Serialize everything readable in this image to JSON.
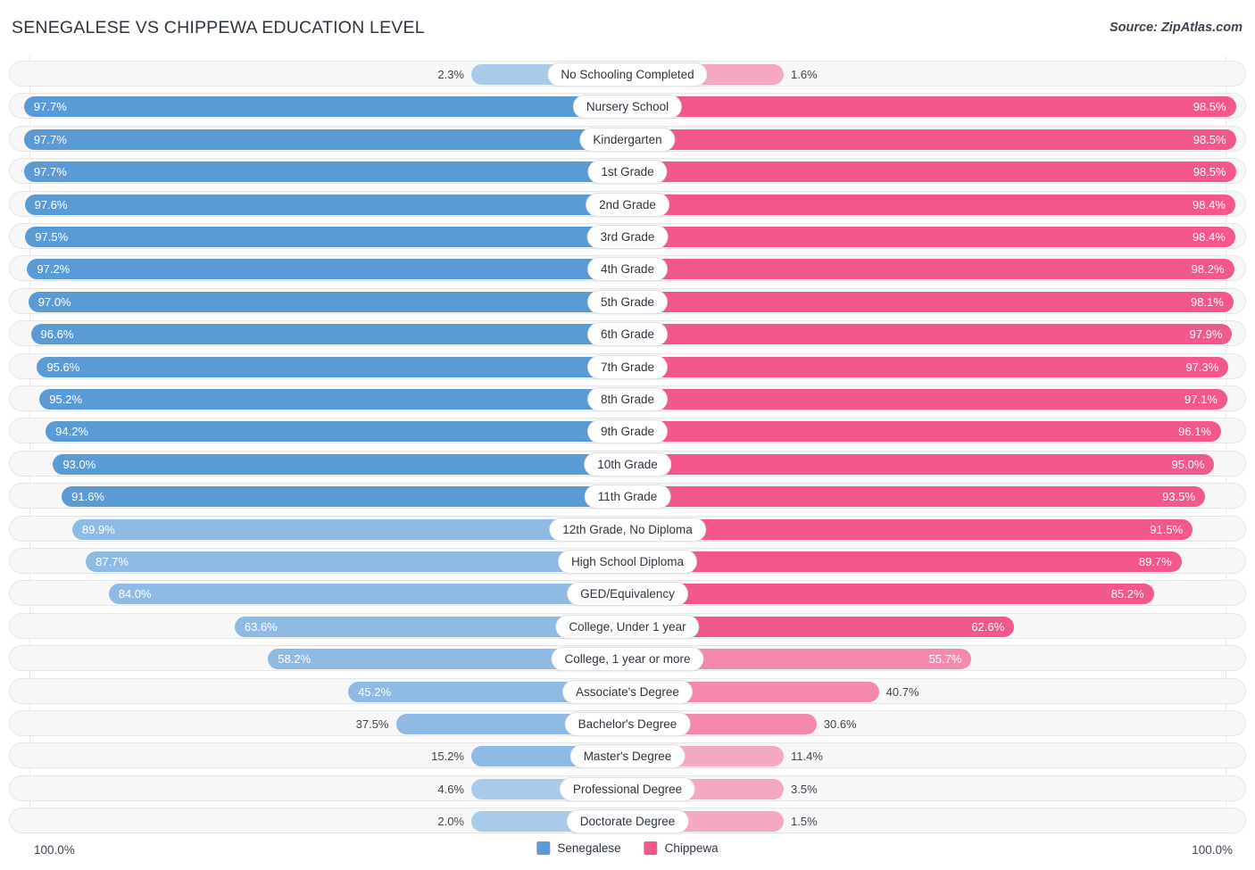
{
  "header": {
    "title": "SENEGALESE VS CHIPPEWA EDUCATION LEVEL",
    "source": "Source: ZipAtlas.com"
  },
  "footer": {
    "axis_left": "100.0%",
    "axis_right": "100.0%",
    "legend": [
      {
        "label": "Senegalese",
        "color": "#5b9bd5"
      },
      {
        "label": "Chippewa",
        "color": "#f2588a"
      }
    ]
  },
  "colors": {
    "blue_strong": "#5b9bd5",
    "blue_light": "#8ebae4",
    "blue_pale": "#a9cbea",
    "pink_strong": "#f2588a",
    "pink_light": "#f589ad",
    "pink_pale": "#f5a8c3",
    "track": "#f7f7f7",
    "track_border": "#e6e6e6",
    "text_dark": "#3f4650"
  },
  "chart_data": {
    "type": "bar",
    "title": "SENEGALESE VS CHIPPEWA EDUCATION LEVEL",
    "orientation": "horizontal-diverging",
    "xlabel": "",
    "ylabel": "",
    "xlim": [
      0,
      100
    ],
    "grid": false,
    "legend_position": "bottom-center",
    "categories": [
      "No Schooling Completed",
      "Nursery School",
      "Kindergarten",
      "1st Grade",
      "2nd Grade",
      "3rd Grade",
      "4th Grade",
      "5th Grade",
      "6th Grade",
      "7th Grade",
      "8th Grade",
      "9th Grade",
      "10th Grade",
      "11th Grade",
      "12th Grade, No Diploma",
      "High School Diploma",
      "GED/Equivalency",
      "College, Under 1 year",
      "College, 1 year or more",
      "Associate's Degree",
      "Bachelor's Degree",
      "Master's Degree",
      "Professional Degree",
      "Doctorate Degree"
    ],
    "series": [
      {
        "name": "Senegalese",
        "color": "#5b9bd5",
        "side": "left",
        "values": [
          2.3,
          97.7,
          97.7,
          97.7,
          97.6,
          97.5,
          97.2,
          97.0,
          96.6,
          95.6,
          95.2,
          94.2,
          93.0,
          91.6,
          89.9,
          87.7,
          84.0,
          63.6,
          58.2,
          45.2,
          37.5,
          15.2,
          4.6,
          2.0
        ],
        "labels": [
          "2.3%",
          "97.7%",
          "97.7%",
          "97.7%",
          "97.6%",
          "97.5%",
          "97.2%",
          "97.0%",
          "96.6%",
          "95.6%",
          "95.2%",
          "94.2%",
          "93.0%",
          "91.6%",
          "89.9%",
          "87.7%",
          "84.0%",
          "63.6%",
          "58.2%",
          "45.2%",
          "37.5%",
          "15.2%",
          "4.6%",
          "2.0%"
        ]
      },
      {
        "name": "Chippewa",
        "color": "#f2588a",
        "side": "right",
        "values": [
          1.6,
          98.5,
          98.5,
          98.5,
          98.4,
          98.4,
          98.2,
          98.1,
          97.9,
          97.3,
          97.1,
          96.1,
          95.0,
          93.5,
          91.5,
          89.7,
          85.2,
          62.6,
          55.7,
          40.7,
          30.6,
          11.4,
          3.5,
          1.5
        ],
        "labels": [
          "1.6%",
          "98.5%",
          "98.5%",
          "98.5%",
          "98.4%",
          "98.4%",
          "98.2%",
          "98.1%",
          "97.9%",
          "97.3%",
          "97.1%",
          "96.1%",
          "95.0%",
          "93.5%",
          "91.5%",
          "89.7%",
          "85.2%",
          "62.6%",
          "55.7%",
          "40.7%",
          "30.6%",
          "11.4%",
          "3.5%",
          "1.5%"
        ]
      }
    ]
  }
}
